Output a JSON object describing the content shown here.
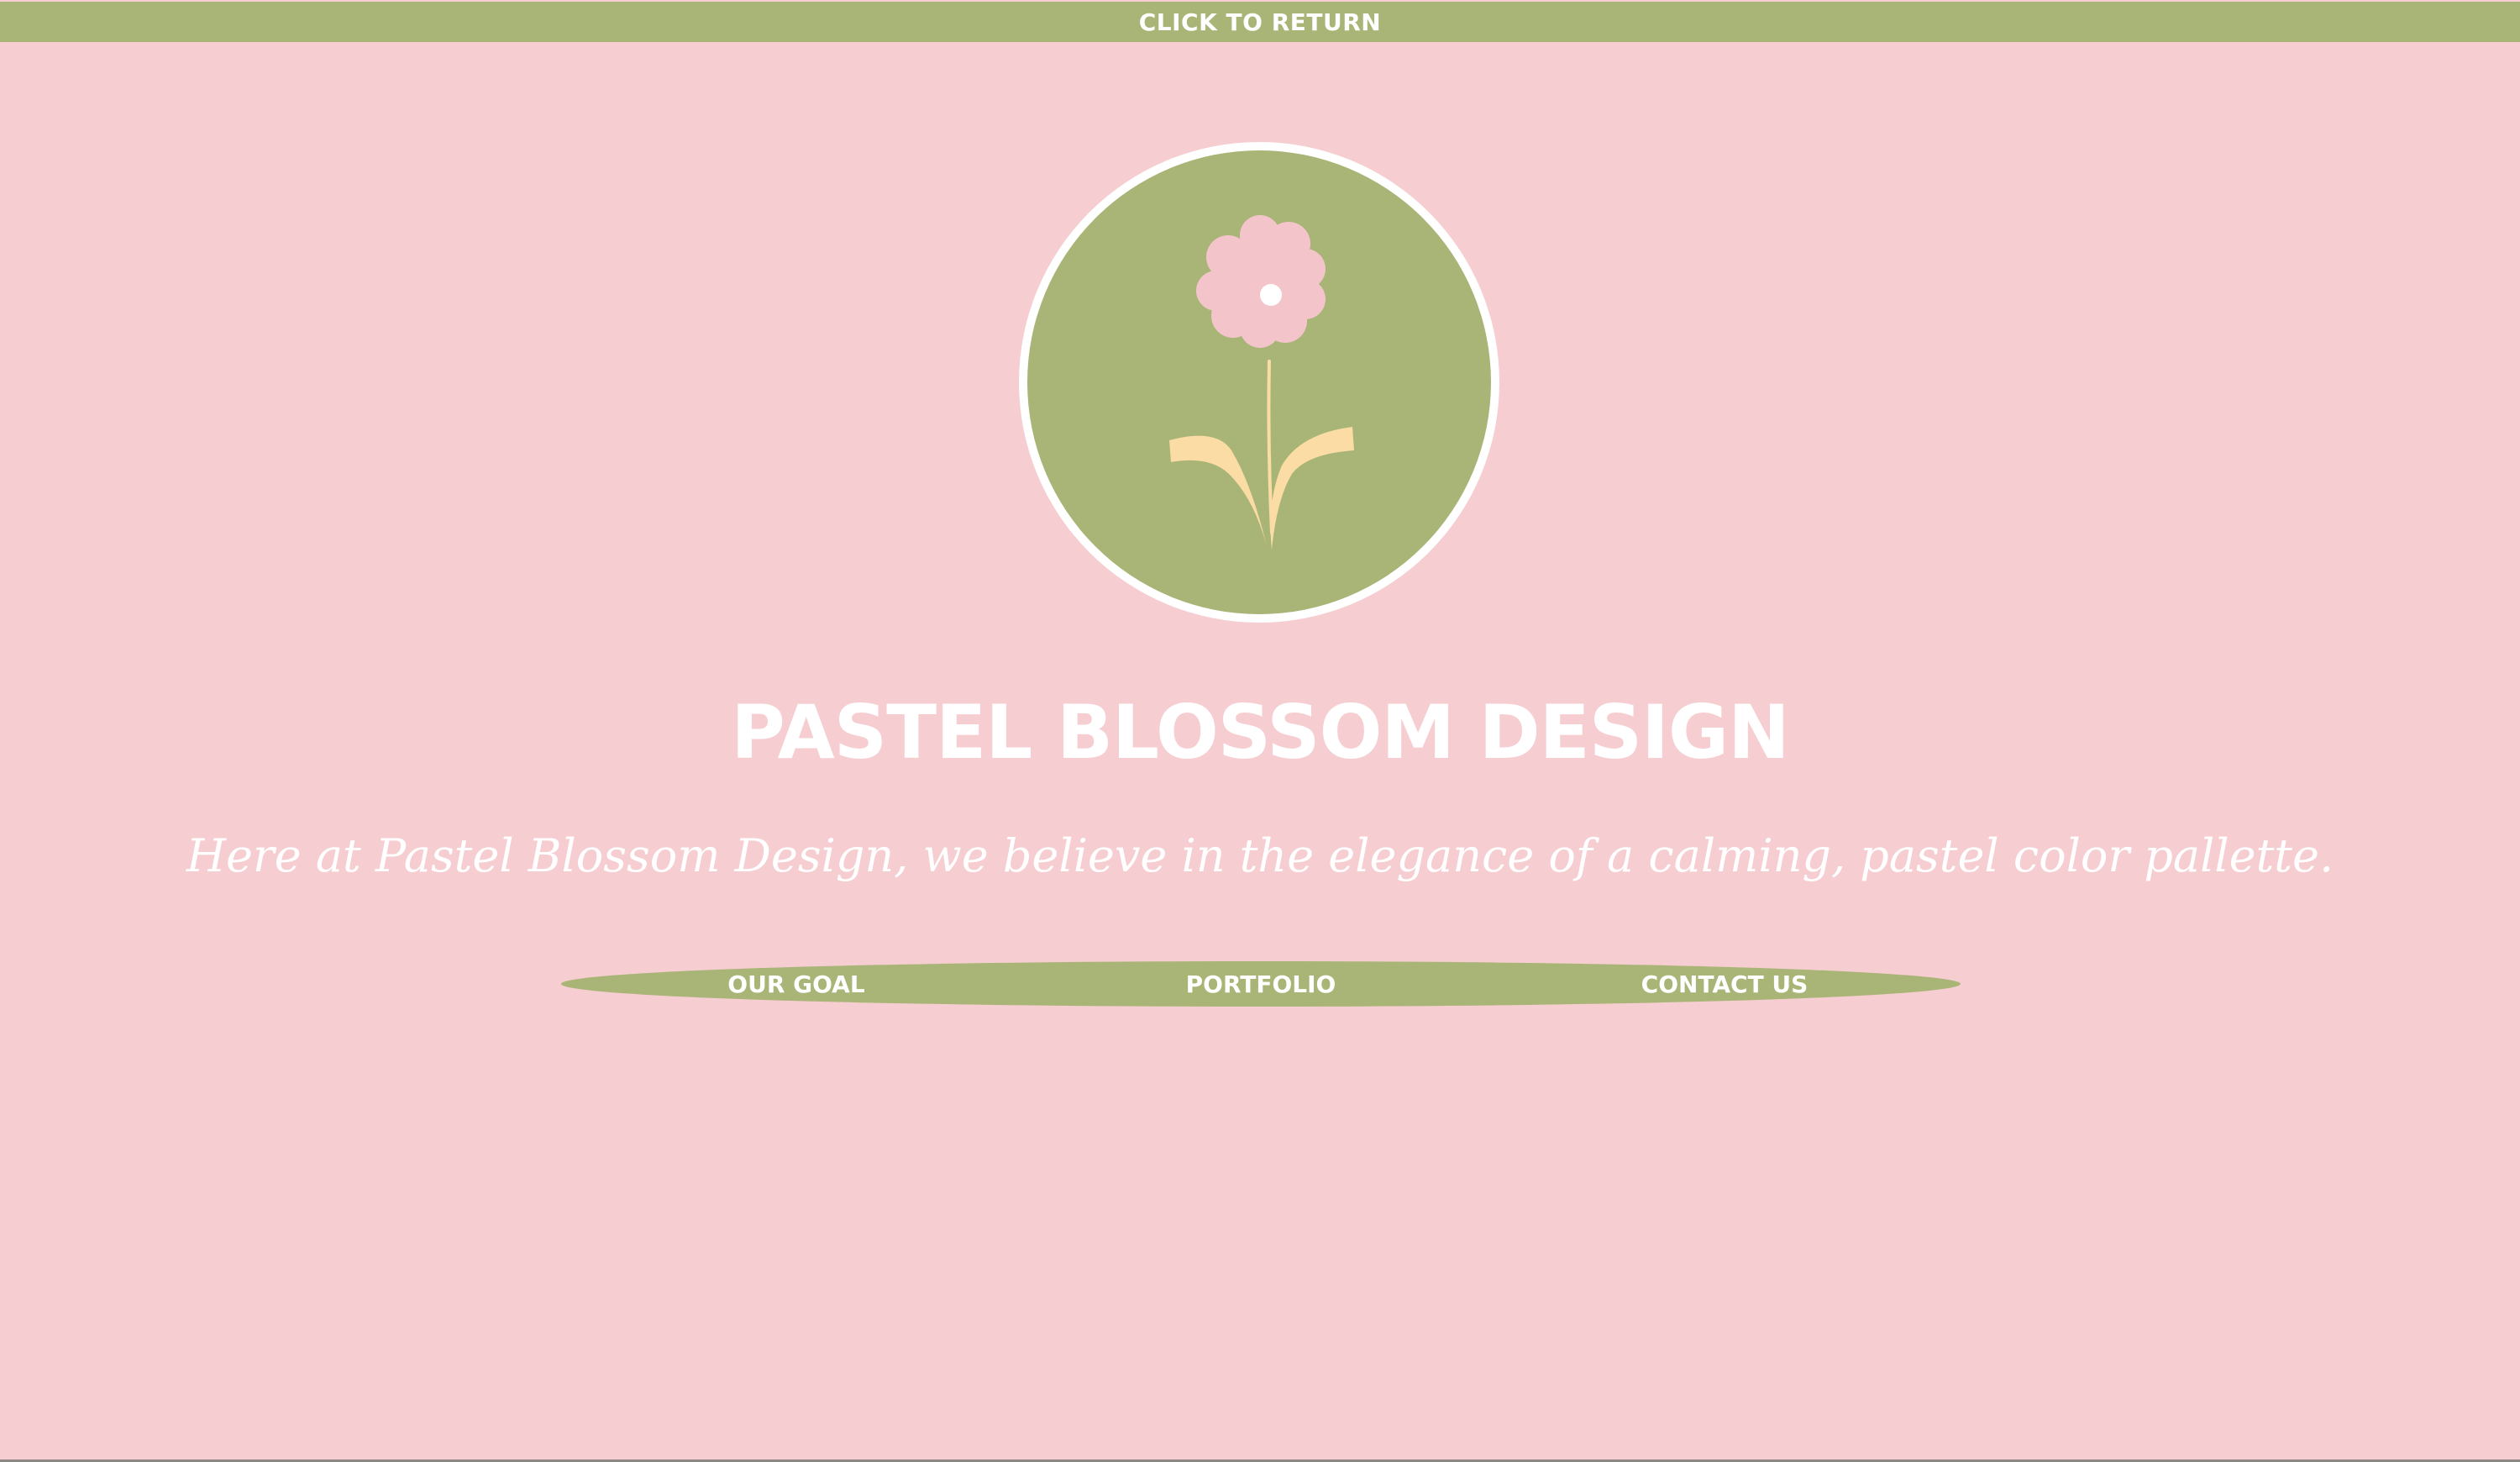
{
  "header": {
    "return_label": "CLICK TO RETURN"
  },
  "hero": {
    "logo_icon": "flower-icon",
    "title": "PASTEL BLOSSOM DESIGN",
    "tagline": "Here at Pastel Blossom Design, we believe in the elegance of a calming, pastel color pallette."
  },
  "nav": {
    "items": [
      {
        "label": "OUR GOAL"
      },
      {
        "label": "PORTFOLIO"
      },
      {
        "label": "CONTACT US"
      }
    ]
  },
  "colors": {
    "background": "#f6cdd0",
    "accent_green": "#a9b577",
    "petal_pink": "#f3c5cb",
    "leaf_yellow": "#fbdca4",
    "text": "#ffffff"
  }
}
